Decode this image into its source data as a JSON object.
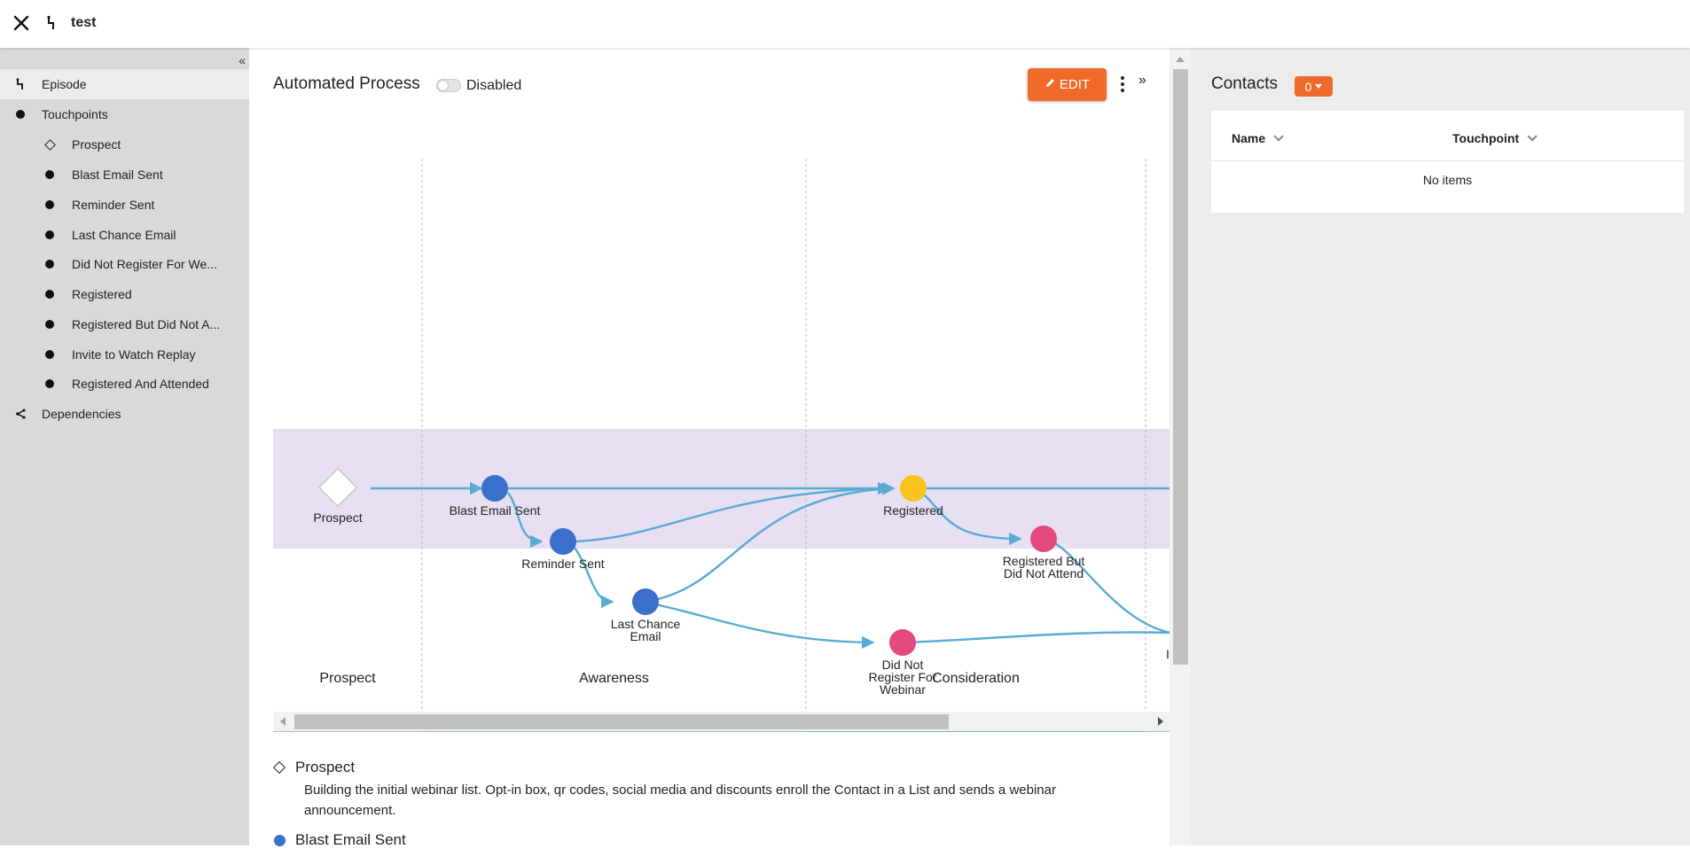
{
  "header": {
    "title": "test"
  },
  "sidebar": {
    "items": [
      {
        "label": "Episode"
      },
      {
        "label": "Touchpoints"
      },
      {
        "label": "Prospect"
      },
      {
        "label": "Blast Email Sent"
      },
      {
        "label": "Reminder Sent"
      },
      {
        "label": "Last Chance Email"
      },
      {
        "label": "Did Not Register For We..."
      },
      {
        "label": "Registered"
      },
      {
        "label": "Registered But Did Not A..."
      },
      {
        "label": "Invite to Watch Replay"
      },
      {
        "label": "Registered And Attended"
      },
      {
        "label": "Dependencies"
      }
    ]
  },
  "main": {
    "title": "Automated Process",
    "toggle_label": "Disabled",
    "toggle_on": false,
    "edit_label": "EDIT"
  },
  "diagram": {
    "nodes": {
      "prospect": "Prospect",
      "blast": "Blast Email Sent",
      "reminder": "Reminder Sent",
      "last_chance_1": "Last Chance",
      "last_chance_2": "Email",
      "registered": "Registered",
      "rbdna_1": "Registered But",
      "rbdna_2": "Did Not Attend",
      "dnr_1": "Did Not",
      "dnr_2": "Register For",
      "dnr_3": "Webinar",
      "cut_label": "I"
    },
    "lanes": [
      "Prospect",
      "Awareness",
      "Consideration"
    ],
    "colors": {
      "edge": "#5aaad6",
      "blue": "#3a6fcc",
      "yellow": "#f7c31f",
      "pink": "#e44a7b",
      "band": "#e6e0f2",
      "lane_prospect": "#c6a9ea",
      "lane_awareness": "#95b6e2",
      "lane_consideration": "#8fa5d6",
      "lane_next": "#8ecbc3"
    }
  },
  "descriptions": [
    {
      "title": "Prospect",
      "body": "Building the initial webinar list. Opt-in box, qr codes, social media and discounts enroll the Contact in a List and sends a webinar announcement."
    },
    {
      "title": "Blast Email Sent",
      "body": ""
    }
  ],
  "contacts": {
    "title": "Contacts",
    "count": "0",
    "columns": [
      "Name",
      "Touchpoint"
    ],
    "empty_text": "No items"
  },
  "accent": "#f06a2a"
}
